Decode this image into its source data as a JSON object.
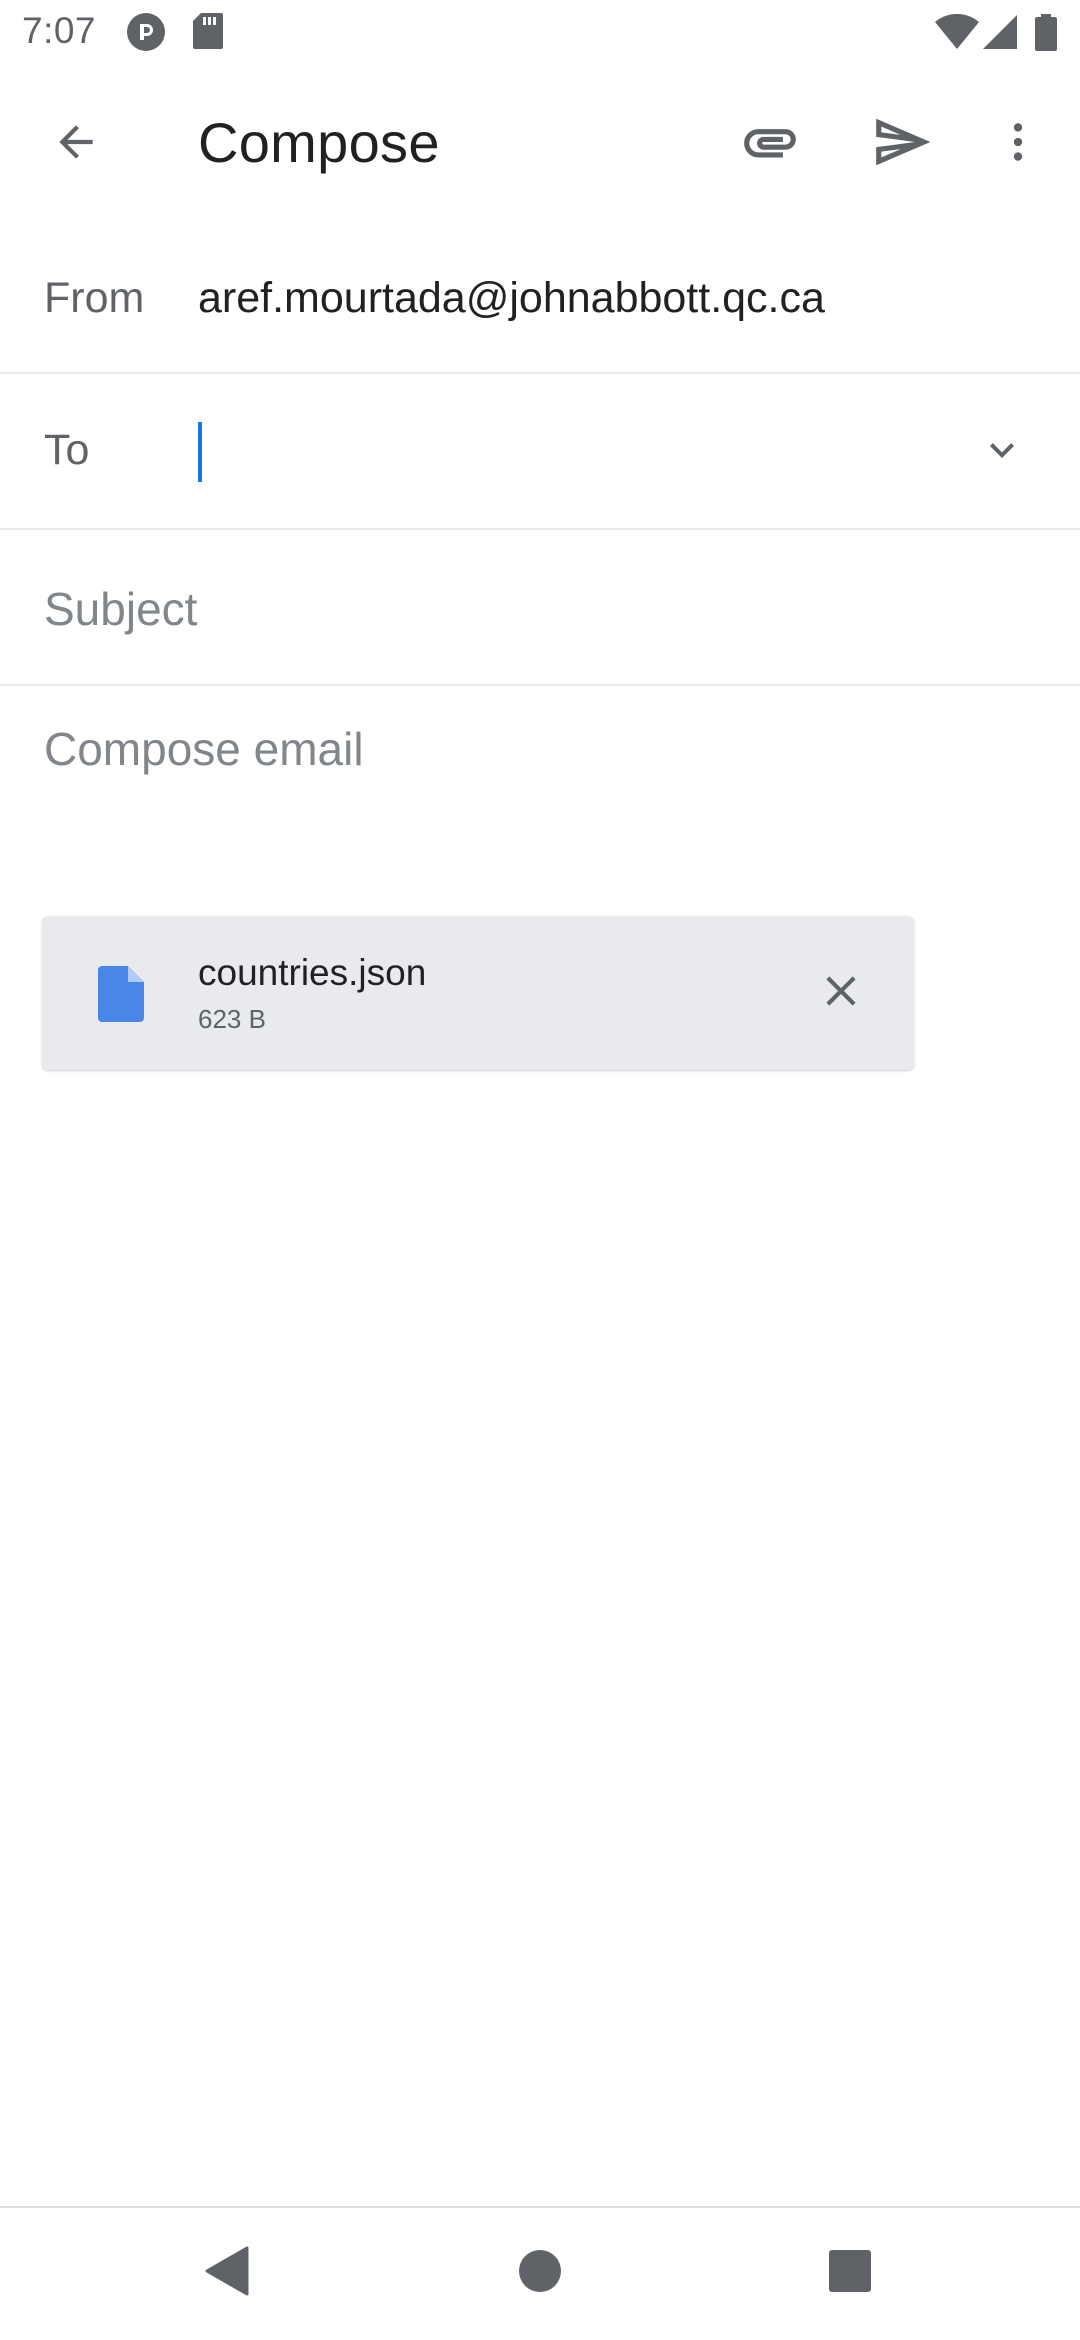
{
  "status_bar": {
    "time": "7:07",
    "left_icons": [
      "pocket-casts-icon",
      "sd-card-icon"
    ],
    "right_icons": [
      "wifi-icon",
      "cellular-signal-icon",
      "battery-icon"
    ]
  },
  "app_bar": {
    "title": "Compose",
    "actions": [
      "back-arrow-icon",
      "paperclip-icon",
      "send-icon",
      "more-vert-icon"
    ]
  },
  "from": {
    "label": "From",
    "value": "aref.mourtada@johnabbott.qc.ca"
  },
  "to": {
    "label": "To",
    "value": ""
  },
  "subject": {
    "placeholder": "Subject",
    "value": ""
  },
  "body": {
    "placeholder": "Compose email",
    "value": ""
  },
  "attachment": {
    "name": "countries.json",
    "size": "623 B",
    "icon": "file-icon",
    "icon_color": "#4a86e8"
  },
  "colors": {
    "accent": "#1a73e8",
    "chip_background": "#e8eaed"
  },
  "nav_bar": {
    "buttons": [
      "back-triangle-icon",
      "home-circle-icon",
      "recents-square-icon"
    ]
  }
}
